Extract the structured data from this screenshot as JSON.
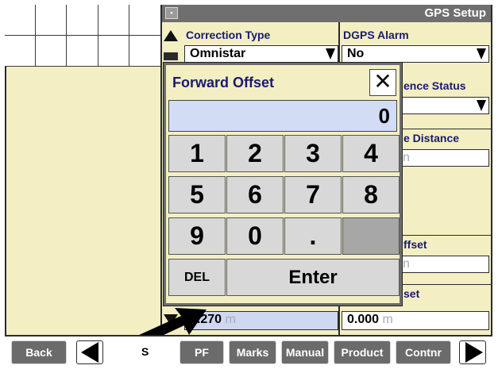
{
  "window": {
    "title": "GPS Setup",
    "icon": "monitor-icon"
  },
  "fields": {
    "correction_type": {
      "label": "Correction Type",
      "value": "Omnistar"
    },
    "dgps_alarm": {
      "label": "DGPS Alarm",
      "value": "No"
    },
    "reference_status": {
      "label_visible": "ence Status"
    },
    "distance": {
      "label_visible": "e Distance",
      "value": "",
      "unit_visible": "n"
    },
    "offset_1": {
      "label_visible": "ffset",
      "unit_visible": "n"
    },
    "offset_2": {
      "label_visible": "set",
      "value": "0.000",
      "unit": "m"
    },
    "left_value": {
      "value": "1.270",
      "unit": "m"
    }
  },
  "dialog": {
    "title": "Forward Offset",
    "close_label": "✕",
    "display_value": "0",
    "keys": [
      "1",
      "2",
      "3",
      "4",
      "5",
      "6",
      "7",
      "8",
      "9",
      "0",
      "."
    ],
    "del_label": "DEL",
    "enter_label": "Enter"
  },
  "toolbar": {
    "back_label": "Back",
    "partial_label": "S",
    "pf_label": "PF",
    "marks_label": "Marks",
    "manual_label": "Manual",
    "product_label": "Product",
    "contnr_label": "Contnr"
  },
  "colors": {
    "panel_bg": "#f3efc3",
    "label_text": "#1a1a6e",
    "titlebar": "#6f6f6f",
    "button_gray": "#6b6b6b",
    "display_blue": "#d2dcf4"
  }
}
